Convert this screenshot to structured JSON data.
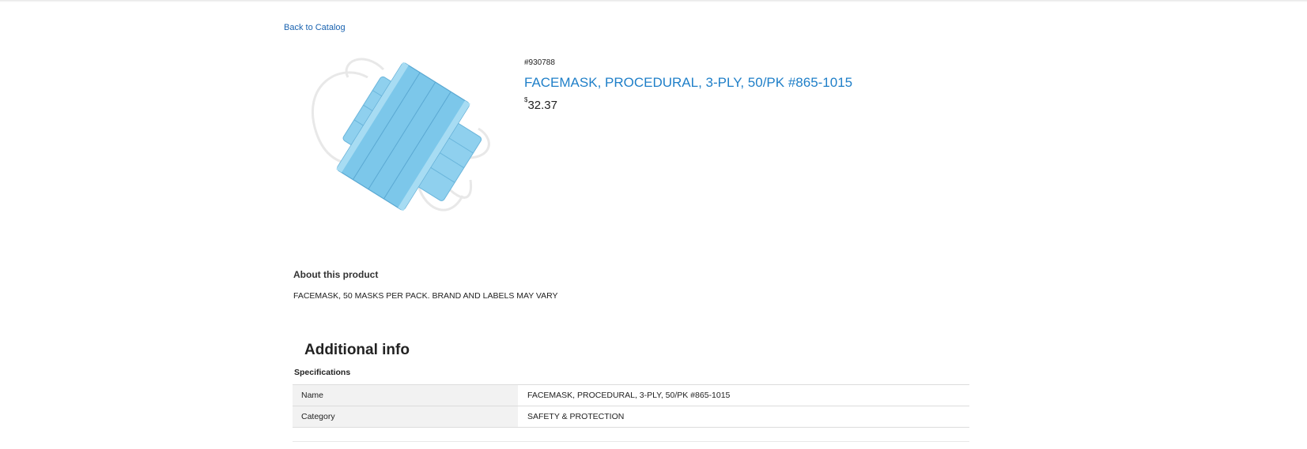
{
  "nav": {
    "back_label": "Back to Catalog"
  },
  "product": {
    "image_alt": "Blue procedural face masks",
    "sku": "#930788",
    "title": "FACEMASK, PROCEDURAL, 3-PLY, 50/PK #865-1015",
    "price_symbol": "$",
    "price_value": "32.37"
  },
  "about": {
    "heading": "About this product",
    "text": "FACEMASK, 50 MASKS PER PACK. BRAND AND LABELS MAY VARY"
  },
  "additional_info": {
    "heading": "Additional info",
    "specs_label": "Specifications",
    "rows": [
      {
        "key": "Name",
        "value": "FACEMASK, PROCEDURAL, 3-PLY, 50/PK #865-1015"
      },
      {
        "key": "Category",
        "value": "SAFETY & PROTECTION"
      }
    ]
  },
  "colors": {
    "link": "#1a63b0",
    "title": "#1f7fc8",
    "mask": "#7cc7ea"
  }
}
